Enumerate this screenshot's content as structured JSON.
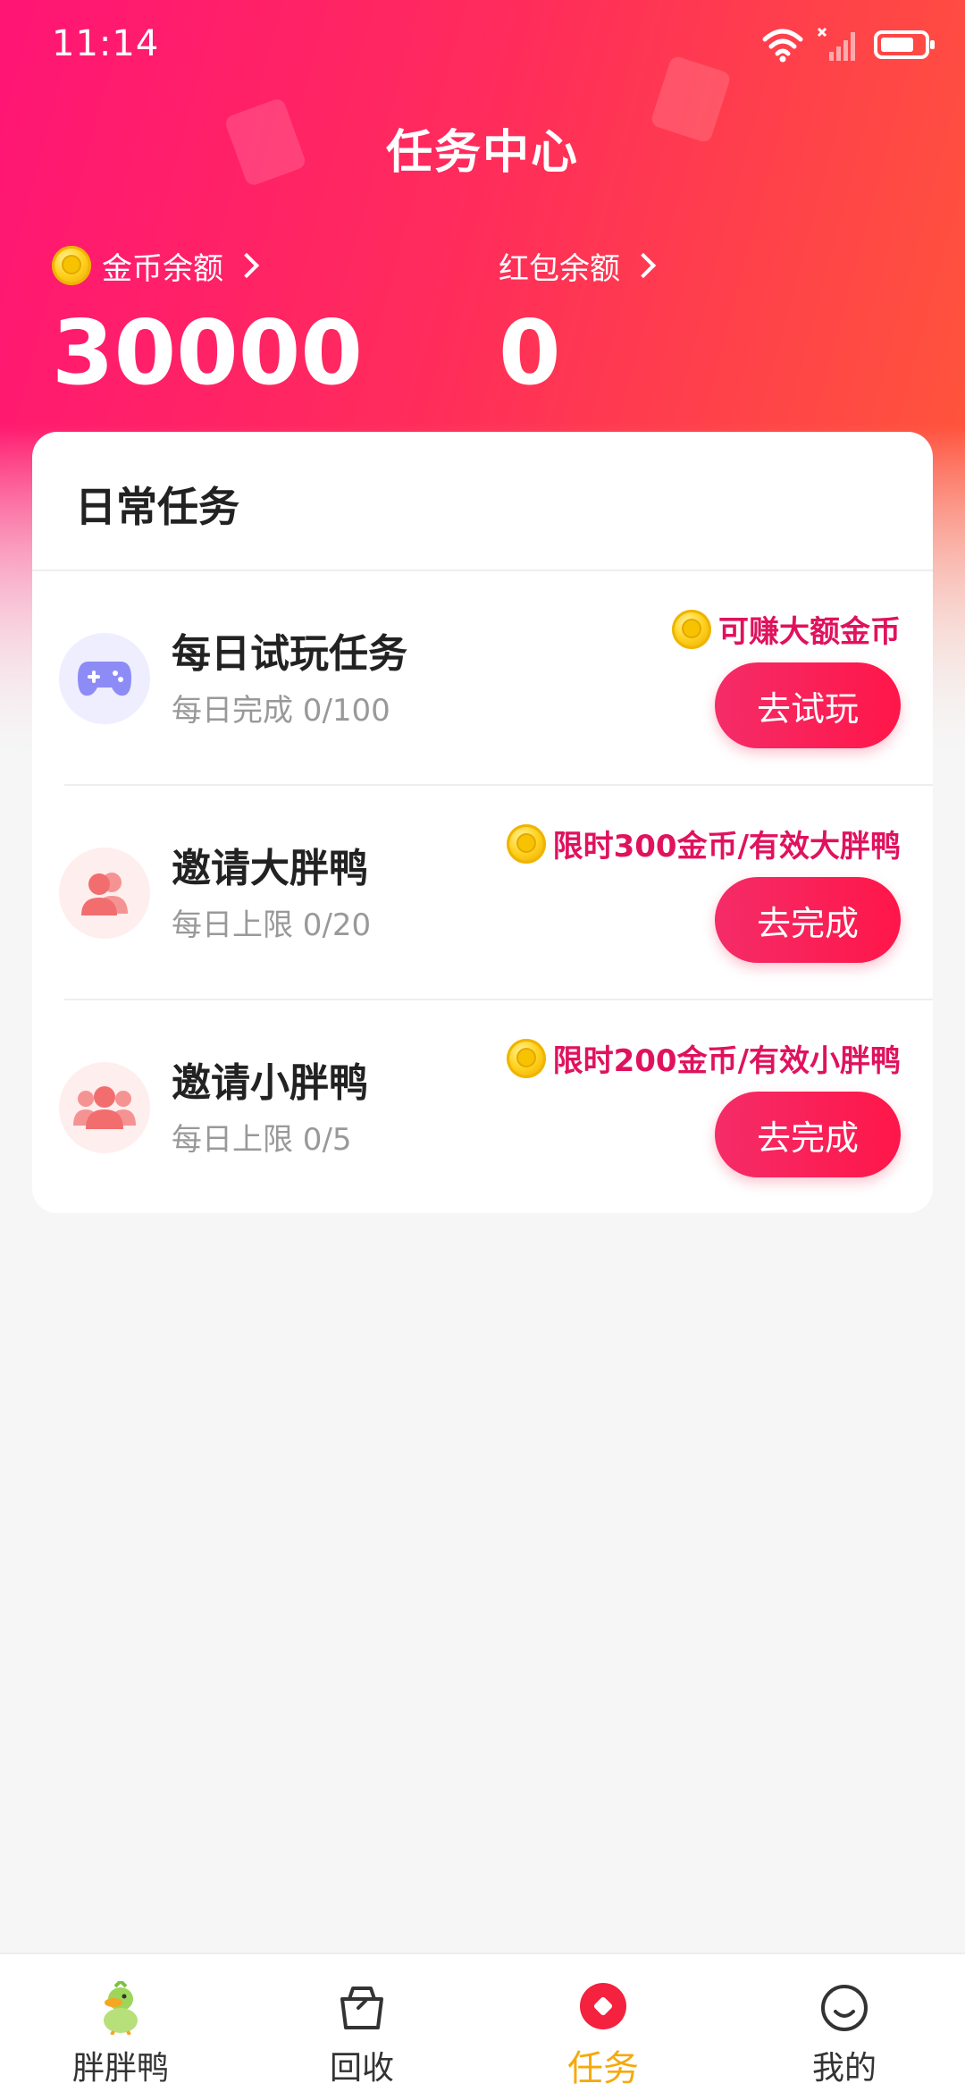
{
  "status_bar": {
    "time": "11:14"
  },
  "header": {
    "title": "任务中心",
    "coin_balance": {
      "label": "金币余额",
      "value": "30000"
    },
    "redpacket_balance": {
      "label": "红包余额",
      "value": "0"
    }
  },
  "daily_tasks": {
    "title": "日常任务",
    "items": [
      {
        "name": "每日试玩任务",
        "progress": "每日完成 0/100",
        "reward": "可赚大额金币",
        "button": "去试玩",
        "icon": "gamepad-icon"
      },
      {
        "name": "邀请大胖鸭",
        "progress": "每日上限 0/20",
        "reward": "限时300金币/有效大胖鸭",
        "button": "去完成",
        "icon": "users-icon"
      },
      {
        "name": "邀请小胖鸭",
        "progress": "每日上限 0/5",
        "reward": "限时200金币/有效小胖鸭",
        "button": "去完成",
        "icon": "group-icon"
      }
    ]
  },
  "tabbar": {
    "items": [
      {
        "label": "胖胖鸭",
        "icon": "duck-mascot-icon",
        "active": false
      },
      {
        "label": "回收",
        "icon": "basket-icon",
        "active": false
      },
      {
        "label": "任务",
        "icon": "task-icon",
        "active": true
      },
      {
        "label": "我的",
        "icon": "smile-face-icon",
        "active": false
      }
    ]
  },
  "colors": {
    "accent": "#ff2c5b",
    "reward_text": "#e0125d",
    "tab_active": "#f6a90c"
  }
}
